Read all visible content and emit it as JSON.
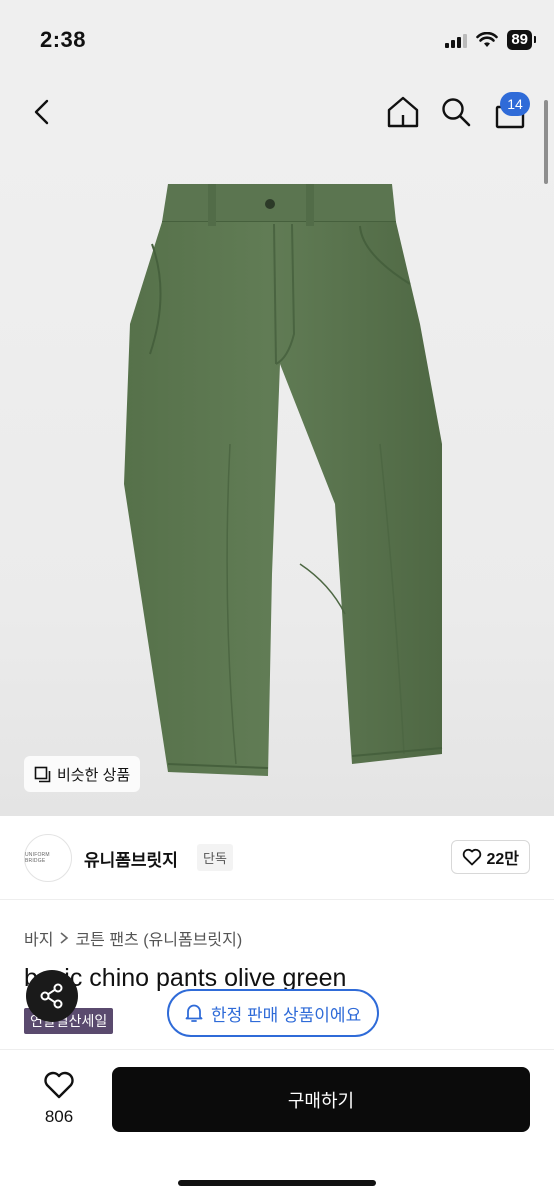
{
  "status": {
    "time": "2:38",
    "battery": "89"
  },
  "nav": {
    "cart_count": "14"
  },
  "image": {
    "similar_label": "비슷한 상품"
  },
  "seller": {
    "avatar_text": "UNIFORM BRIDGE",
    "name": "유니폼브릿지",
    "tag": "단독",
    "likes": "22만"
  },
  "breadcrumb": {
    "category": "바지",
    "subcategory": "코튼 팬츠 (유니폼브릿지)"
  },
  "product": {
    "title": "basic chino pants olive green",
    "sale_badge": "연말결산세일"
  },
  "floating": {
    "limited_text": "한정 판매 상품이에요"
  },
  "footer": {
    "wish_count": "806",
    "buy_label": "구매하기"
  },
  "colors": {
    "accent": "#2f6bd8",
    "olive": "#5f7a52",
    "buy": "#0b0b0b"
  }
}
